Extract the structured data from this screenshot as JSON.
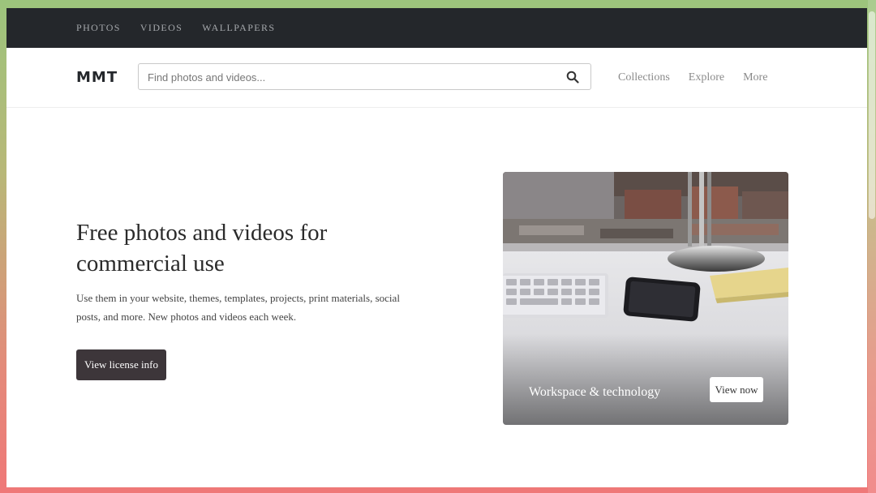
{
  "top_nav": {
    "items": [
      {
        "label": "PHOTOS"
      },
      {
        "label": "VIDEOS"
      },
      {
        "label": "WALLPAPERS"
      }
    ]
  },
  "header": {
    "logo": "MMT",
    "search": {
      "placeholder": "Find photos and videos...",
      "value": ""
    },
    "search_icon": "search-icon",
    "nav": [
      {
        "label": "Collections"
      },
      {
        "label": "Explore"
      },
      {
        "label": "More"
      }
    ]
  },
  "hero": {
    "title": "Free photos and videos for commercial use",
    "description": "Use them in your website, themes, templates, projects, print materials, social posts, and more. New photos and videos each week.",
    "button_label": "View license info"
  },
  "featured_card": {
    "caption": "Workspace & technology",
    "button_label": "View now"
  },
  "colors": {
    "topbar": "#24272b",
    "button_dark": "#3d363a",
    "background_top": "#9cc47c",
    "background_bottom": "#ef7878"
  }
}
